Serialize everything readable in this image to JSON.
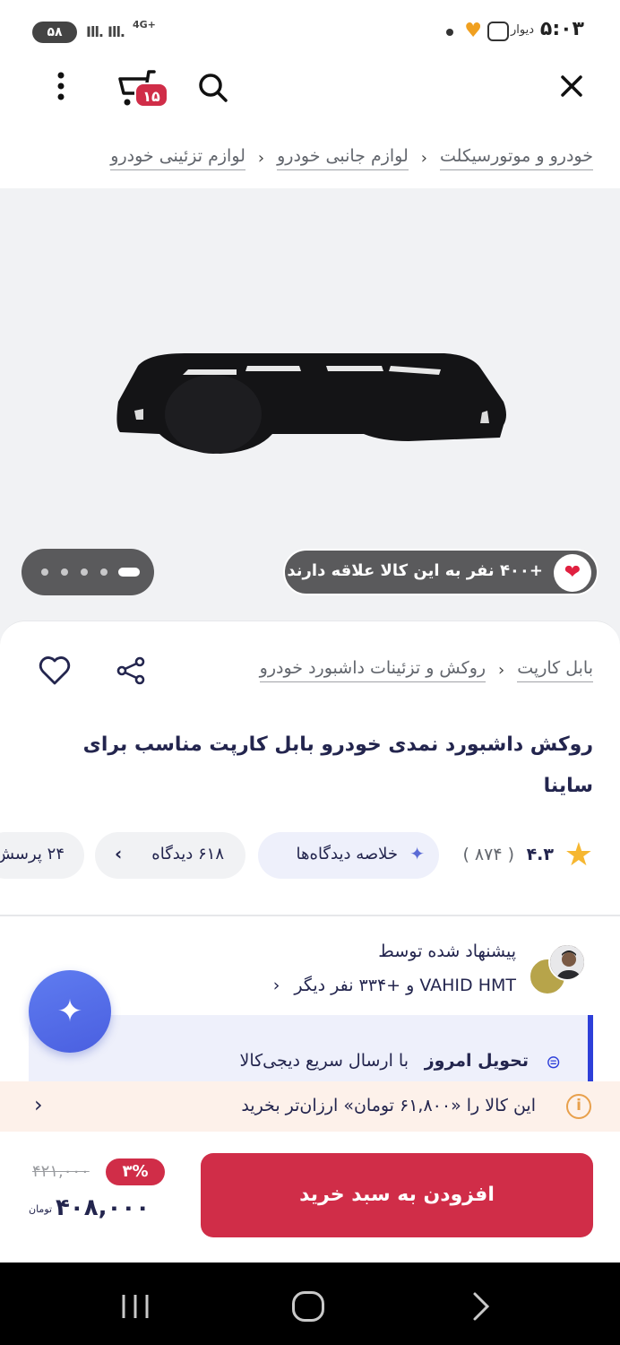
{
  "status_bar": {
    "time": "۵:۰۳",
    "app_label": "دیوار",
    "battery": "۵۸",
    "network": "4G+"
  },
  "app_bar": {
    "cart_count": "۱۵"
  },
  "breadcrumb": {
    "items": [
      "خودرو و موتورسیکلت",
      "لوازم جانبی خودرو",
      "لوازم تزئینی خودرو"
    ]
  },
  "gallery": {
    "like_text": "+۴۰۰ نفر به این کالا علاقه دارند",
    "slide_count": 5,
    "active_slide": 1
  },
  "product": {
    "brand_crumb": [
      "بابل کارپت",
      "روکش و تزئینات داشبورد خودرو"
    ],
    "title": "روکش داشبورد نمدی خودرو بابل کارپت مناسب برای ساینا",
    "rating": "۴.۳",
    "rating_count": "( ۸۷۴ )",
    "summary_chip": "خلاصه دیدگاه‌ها",
    "reviews_chip": "۶۱۸ دیدگاه",
    "qa_chip": "۲۴ پرسش"
  },
  "suggested": {
    "title": "پیشنهاد شده توسط",
    "subtitle": "VAHID HMT و +۳۳۴ نفر دیگر"
  },
  "delivery": {
    "strong": "تحویل امروز",
    "rest": "با ارسال سریع دیجی‌کالا"
  },
  "cheaper_banner": {
    "text": "این کالا را «۶۱,۸۰۰ تومان» ارزان‌تر بخرید"
  },
  "purchase": {
    "button_label": "افزودن به سبد خرید",
    "old_price": "۴۲۱,۰۰۰",
    "discount": "۳%",
    "price": "۴۰۸,۰۰۰",
    "currency": "تومان"
  },
  "colors": {
    "primary": "#d02d48",
    "accent_blue": "#2d3fd9",
    "text": "#23254e",
    "star": "#f6b731"
  }
}
